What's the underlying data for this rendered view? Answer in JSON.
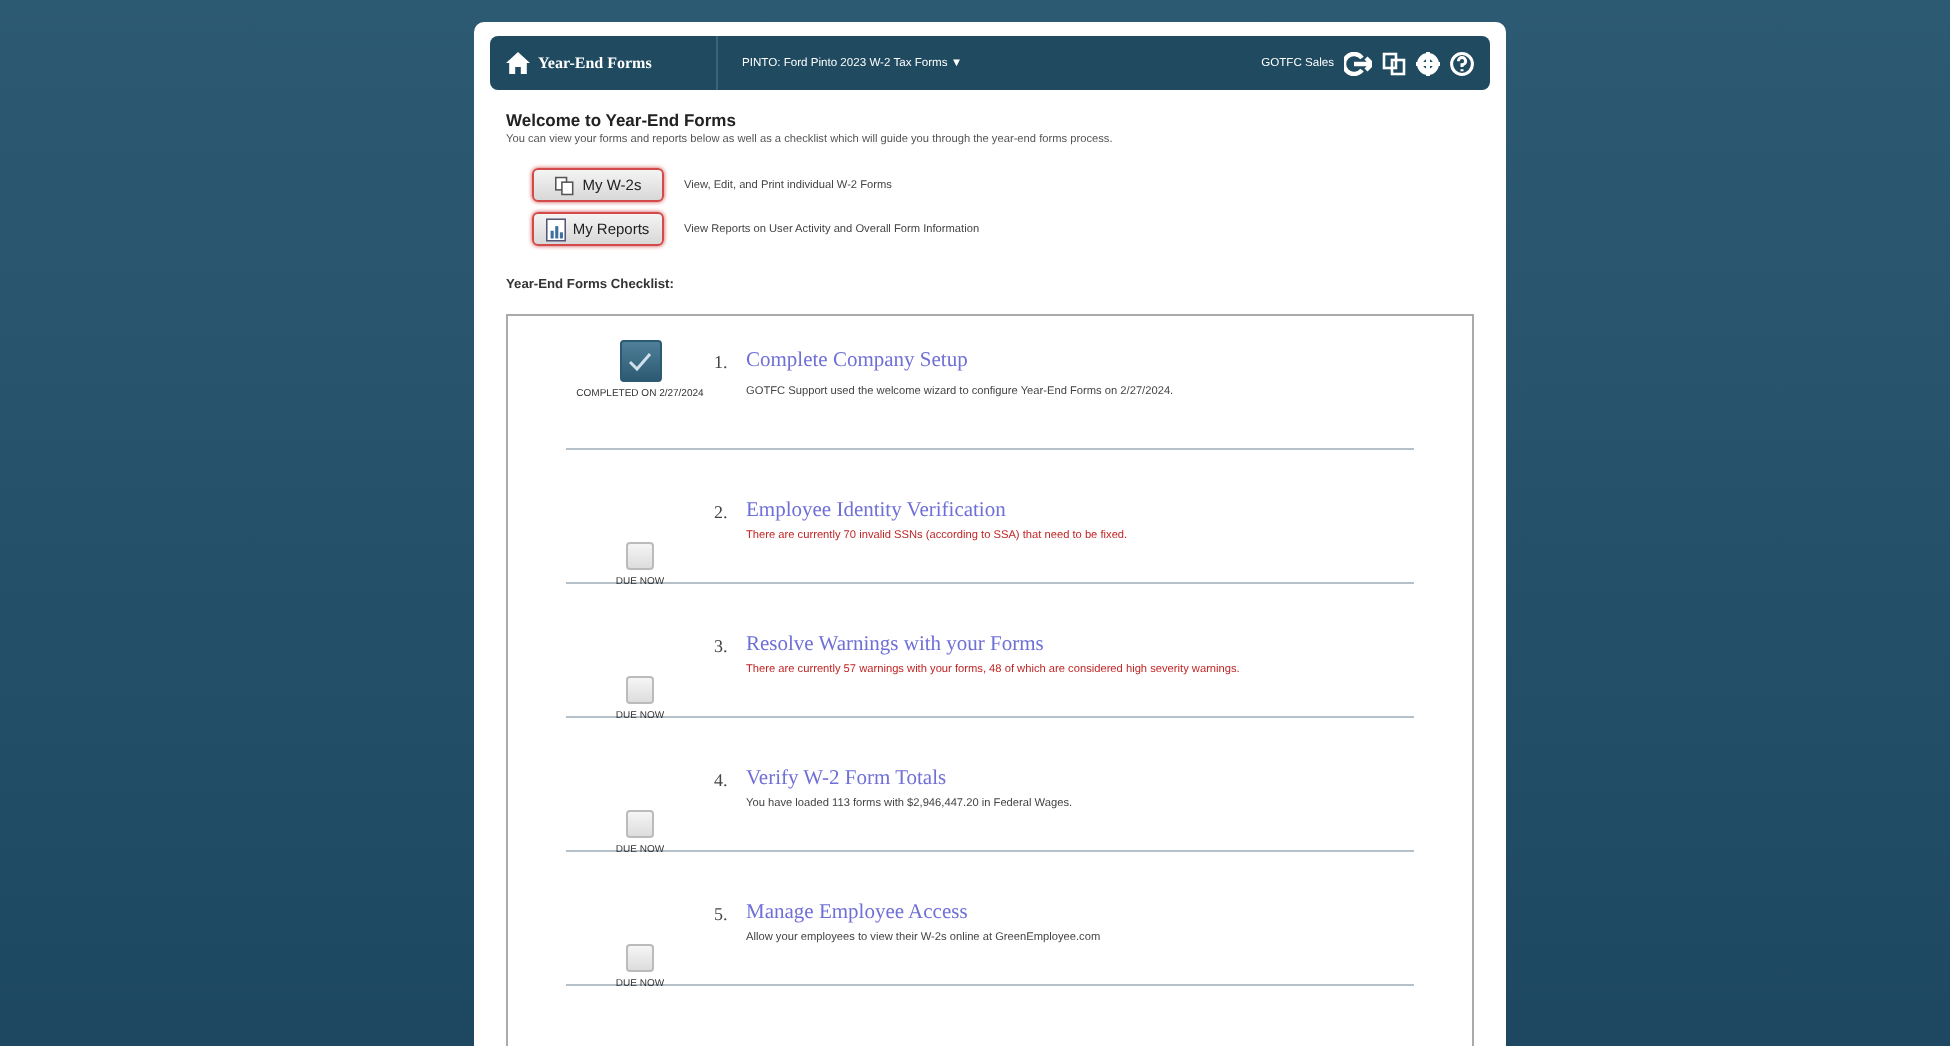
{
  "header": {
    "title": "Year-End Forms",
    "company": "PINTO: Ford Pinto 2023 W-2 Tax Forms ▼",
    "user": "GOTFC Sales"
  },
  "welcome": {
    "title": "Welcome to Year-End Forms",
    "text": "You can view your forms and reports below as well as a checklist which will guide you through the year-end forms process."
  },
  "actions": [
    {
      "kind": "forms",
      "label": "My W-2s",
      "description": "View, Edit, and Print individual W-2 Forms"
    },
    {
      "kind": "reports",
      "label": "My Reports",
      "description": "View Reports on User Activity and Overall Form Information"
    }
  ],
  "checklist": {
    "title": "Year-End Forms Checklist:",
    "items": [
      {
        "number": "1.",
        "title": "Complete Company Setup",
        "status": "COMPLETED ON 2/27/2024",
        "checked": true,
        "warning": false,
        "text": "GOTFC Support used the welcome wizard to configure Year-End Forms on 2/27/2024."
      },
      {
        "number": "2.",
        "title": "Employee Identity Verification",
        "status": "DUE NOW",
        "checked": false,
        "warning": true,
        "text": "There are currently 70 invalid SSNs (according to SSA) that need to be fixed."
      },
      {
        "number": "3.",
        "title": "Resolve Warnings with your Forms",
        "status": "DUE NOW",
        "checked": false,
        "warning": true,
        "text": "There are currently 57 warnings with your forms, 48 of which are considered high severity warnings."
      },
      {
        "number": "4.",
        "title": "Verify W-2 Form Totals",
        "status": "DUE NOW",
        "checked": false,
        "warning": false,
        "text": "You have loaded 113 forms with $2,946,447.20 in Federal Wages."
      },
      {
        "number": "5.",
        "title": "Manage Employee Access",
        "status": "DUE NOW",
        "checked": false,
        "warning": false,
        "text": "Allow your employees to view their W-2s online at GreenEmployee.com"
      }
    ]
  }
}
